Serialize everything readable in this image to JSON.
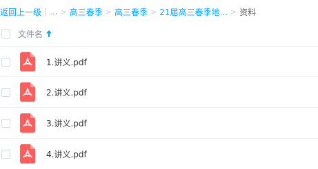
{
  "breadcrumb": {
    "back": "返回上一级",
    "ellipsis": "...",
    "items": [
      "高三春季",
      "高三春季",
      "21届高三春季地...",
      "资料"
    ]
  },
  "list_header": {
    "name_column": "文件名"
  },
  "files": [
    {
      "name": "1.讲义.pdf",
      "icon": "pdf-file-icon"
    },
    {
      "name": "2.讲义.pdf",
      "icon": "pdf-file-icon"
    },
    {
      "name": "3.讲义.pdf",
      "icon": "pdf-file-icon"
    },
    {
      "name": "4.讲义.pdf",
      "icon": "pdf-file-icon"
    }
  ],
  "colors": {
    "link": "#06a7ff",
    "pdf": "#ff5c5c"
  }
}
